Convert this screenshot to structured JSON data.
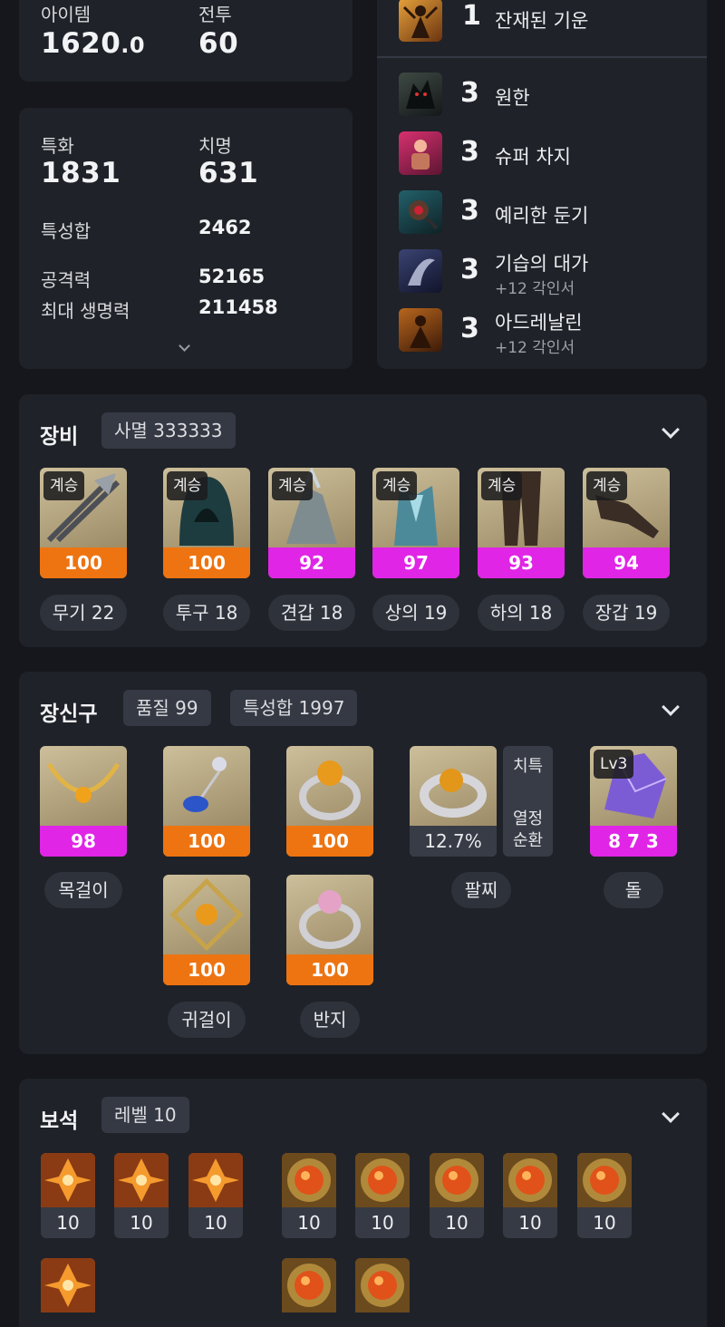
{
  "stats_top": {
    "item_label": "아이템",
    "item_value": "1620",
    "item_decimal": ".0",
    "combat_label": "전투",
    "combat_value": "60"
  },
  "stats_card": {
    "spec_label": "특화",
    "spec_value": "1831",
    "crit_label": "치명",
    "crit_value": "631",
    "total_label": "특성합",
    "total_value": "2462",
    "atk_label": "공격력",
    "atk_value": "52165",
    "hp_label": "최대 생명력",
    "hp_value": "211458",
    "expand_icon": "chevron-down-icon"
  },
  "engravings": {
    "top": {
      "level": "1",
      "name": "잔재된 기운"
    },
    "items": [
      {
        "level": "3",
        "name": "원한",
        "sub": ""
      },
      {
        "level": "3",
        "name": "슈퍼 차지",
        "sub": ""
      },
      {
        "level": "3",
        "name": "예리한 둔기",
        "sub": ""
      },
      {
        "level": "3",
        "name": "기습의 대가",
        "sub": "+12 각인서"
      },
      {
        "level": "3",
        "name": "아드레날린",
        "sub": "+12 각인서"
      }
    ]
  },
  "equipment": {
    "title": "장비",
    "set_chip": "사멸 333333",
    "tag": "계승",
    "items": [
      {
        "quality": "100",
        "name": "무기 22",
        "color": "orange"
      },
      {
        "quality": "100",
        "name": "투구 18",
        "color": "orange"
      },
      {
        "quality": "92",
        "name": "견갑 18",
        "color": "magenta"
      },
      {
        "quality": "97",
        "name": "상의 19",
        "color": "magenta"
      },
      {
        "quality": "93",
        "name": "하의 18",
        "color": "magenta"
      },
      {
        "quality": "94",
        "name": "장갑 19",
        "color": "magenta"
      }
    ]
  },
  "accessories": {
    "title": "장신구",
    "quality_chip": "품질 99",
    "total_chip": "특성합 1997",
    "necklace": {
      "quality": "98",
      "name": "목걸이"
    },
    "earring1": {
      "quality": "100"
    },
    "earring2": {
      "quality": "100"
    },
    "earring_name": "귀걸이",
    "ring1": {
      "quality": "100"
    },
    "ring2": {
      "quality": "100"
    },
    "ring_name": "반지",
    "bracelet": {
      "value": "12.7%",
      "name": "팔찌",
      "opt1": "치특",
      "opt2": "열정",
      "opt3": "순환"
    },
    "stone": {
      "level": "Lv3",
      "value": "8 7 3",
      "name": "돌"
    }
  },
  "gems": {
    "title": "보석",
    "level_chip": "레벨 10",
    "row1": [
      "10",
      "10",
      "10",
      "10",
      "10",
      "10",
      "10",
      "10"
    ]
  },
  "colors": {
    "orange": "#ee7411",
    "magenta": "#e025e6",
    "card": "#1f2228",
    "background": "#15171c"
  }
}
